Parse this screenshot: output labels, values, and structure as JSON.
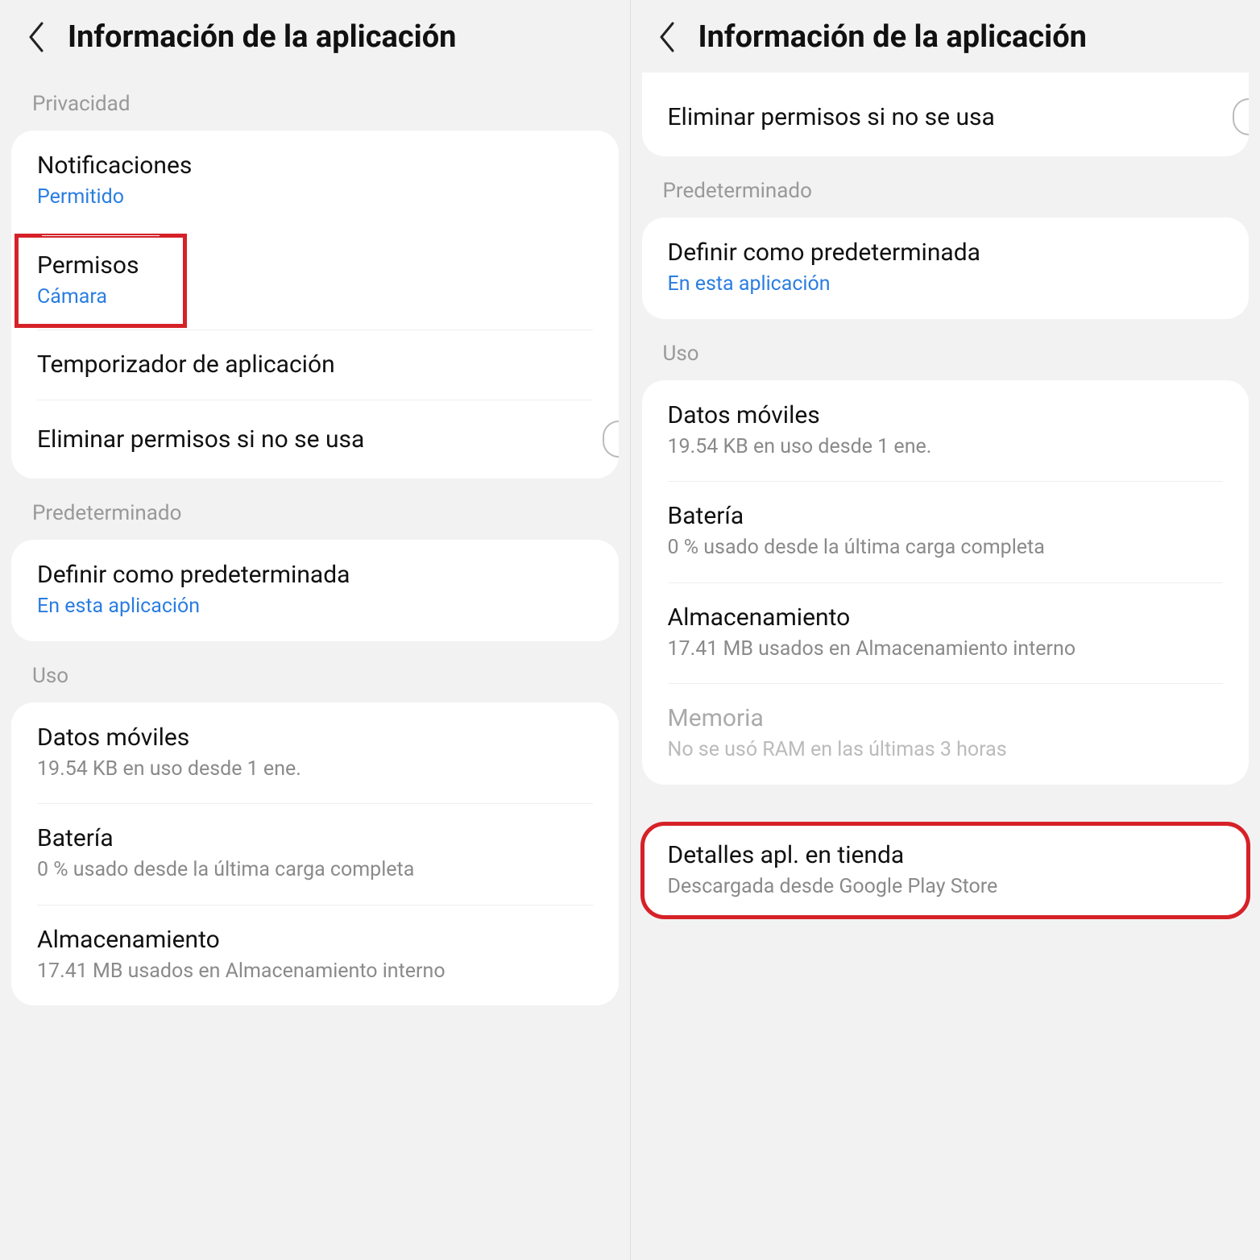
{
  "left": {
    "header": {
      "title": "Información de la aplicación"
    },
    "privacidad": {
      "label": "Privacidad",
      "notificaciones": {
        "title": "Notificaciones",
        "sub": "Permitido"
      },
      "permisos": {
        "title": "Permisos",
        "sub": "Cámara"
      },
      "temporizador": {
        "title": "Temporizador de aplicación"
      },
      "eliminar": {
        "title": "Eliminar permisos si no se usa"
      }
    },
    "predeterminado": {
      "label": "Predeterminado",
      "definir": {
        "title": "Definir como predeterminada",
        "sub": "En esta aplicación"
      }
    },
    "uso": {
      "label": "Uso",
      "datos": {
        "title": "Datos móviles",
        "sub": "19.54 KB en uso desde 1 ene."
      },
      "bateria": {
        "title": "Batería",
        "sub": "0 % usado desde la última carga completa"
      },
      "almacenamiento": {
        "title": "Almacenamiento",
        "sub": "17.41 MB usados en Almacenamiento interno"
      }
    }
  },
  "right": {
    "header": {
      "title": "Información de la aplicación"
    },
    "eliminar": {
      "title": "Eliminar permisos si no se usa"
    },
    "predeterminado": {
      "label": "Predeterminado",
      "definir": {
        "title": "Definir como predeterminada",
        "sub": "En esta aplicación"
      }
    },
    "uso": {
      "label": "Uso",
      "datos": {
        "title": "Datos móviles",
        "sub": "19.54 KB en uso desde 1 ene."
      },
      "bateria": {
        "title": "Batería",
        "sub": "0 % usado desde la última carga completa"
      },
      "almacenamiento": {
        "title": "Almacenamiento",
        "sub": "17.41 MB usados en Almacenamiento interno"
      },
      "memoria": {
        "title": "Memoria",
        "sub": "No se usó RAM en las últimas 3 horas"
      }
    },
    "detalles": {
      "title": "Detalles apl. en tienda",
      "sub": "Descargada desde Google Play Store"
    }
  }
}
